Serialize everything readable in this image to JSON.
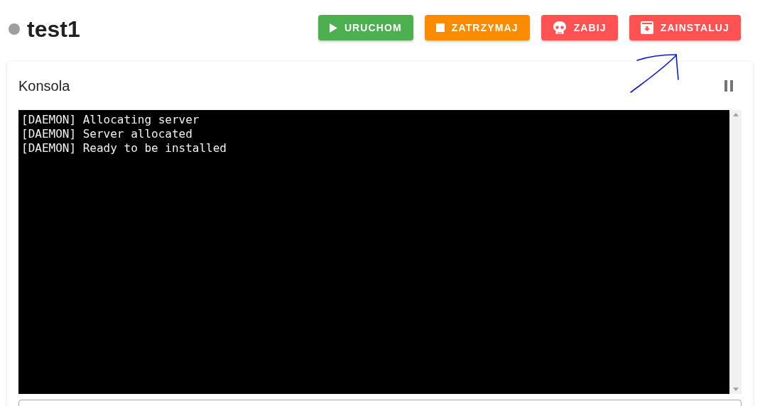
{
  "server": {
    "title": "test1",
    "color": "#9e9e9e"
  },
  "buttons": [
    {
      "label": "URUCHOM",
      "kind": "play",
      "color": "#4caf50"
    },
    {
      "label": "ZATRZYMAJ",
      "kind": "stop",
      "color": "#fb8c00"
    },
    {
      "label": "ZABIJ",
      "kind": "skull",
      "color": "#ff5252"
    },
    {
      "label": "ZAINSTALUJ",
      "kind": "install",
      "color": "#ff5252"
    }
  ],
  "console": {
    "title": "Konsola",
    "lines": [
      "[DAEMON] Allocating server",
      "[DAEMON] Server allocated",
      "[DAEMON] Ready to be installed"
    ]
  }
}
